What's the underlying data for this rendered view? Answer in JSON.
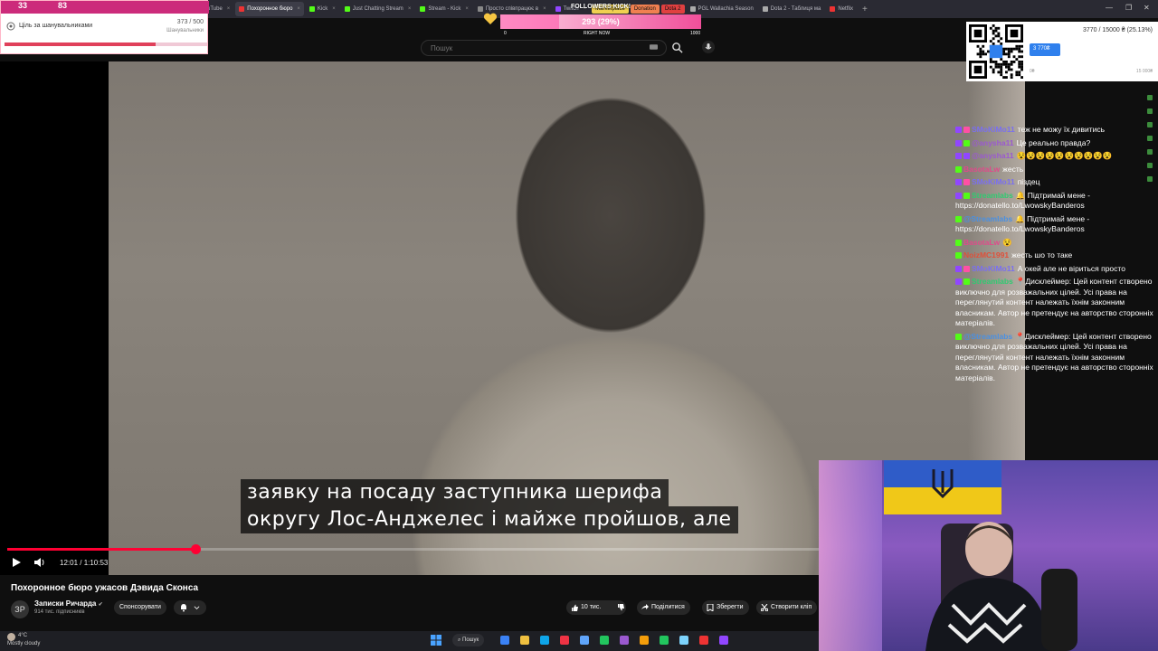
{
  "browser": {
    "tabs": [
      {
        "label": "Ніхто не очікує де",
        "color": "#e33"
      },
      {
        "label": "Я СКОРО УМРУ. БУД",
        "color": "#e33"
      },
      {
        "label": "PENGBORN - YouTube",
        "color": "#e33"
      },
      {
        "label": "Похоронное бюро",
        "color": "#e33",
        "active": true
      },
      {
        "label": "Kick",
        "color": "#53fc18"
      },
      {
        "label": "Just Chatting Stream",
        "color": "#53fc18"
      },
      {
        "label": "Stream - Kick",
        "color": "#53fc18"
      },
      {
        "label": "Просто співпрацює в",
        "color": "#888"
      },
      {
        "label": "Twitch",
        "color": "#9146ff"
      }
    ],
    "pills": [
      {
        "label": "Marketplace",
        "color": "#f0d050"
      },
      {
        "label": "Donation",
        "color": "#f08050"
      },
      {
        "label": "Dota 2",
        "color": "#e04040"
      }
    ],
    "extra_tabs": [
      {
        "label": "PGL Wallachia Season",
        "color": "#aaa"
      },
      {
        "label": "Dota 2 - Таблиця ма",
        "color": "#aaa"
      },
      {
        "label": "Netflix",
        "color": "#e33"
      }
    ],
    "newtab": "+",
    "window_controls": [
      "⌄",
      "—",
      "❐",
      "✕"
    ]
  },
  "youtube": {
    "search_placeholder": "Пошук",
    "video": {
      "subtitle_lines": [
        "заявку на посаду заступника шерифа",
        "округу Лос-Анджелес і майже пройшов, але"
      ],
      "time": "12:01 / 1:10:53",
      "progress_fraction": 0.2319
    },
    "title": "Похоронное бюро ужасов Дэвида Сконса",
    "channel": {
      "avatar_text": "ЗР",
      "name": "Записки Ричарда",
      "verified": "✔",
      "subs": "914 тис. підписників"
    },
    "sponsor_label": "Спонсорувати",
    "actions": {
      "like": "10 тис.",
      "share": "Поділитися",
      "save": "Зберегти",
      "clip": "Створити кліп"
    }
  },
  "overlay": {
    "stats": {
      "a": "33",
      "b": "83"
    },
    "goal": {
      "label": "Ціль за шанувальниками",
      "count": "373 / 500",
      "sub": "Шанувальники",
      "fraction": 0.746
    },
    "kick": {
      "title": "FOLLOWERS KICK!",
      "value": "293 (29%)",
      "fraction": 0.293,
      "min": "0",
      "mid": "RIGHT NOW",
      "max": "1000"
    },
    "donation": {
      "total": "3770 / 15000 ₴ (25.13%)",
      "bar_label": "3 770₴",
      "amount": "",
      "min": "0₴",
      "max": "15 000₴",
      "fraction": 0.2513
    }
  },
  "chat": [
    {
      "user": "SMoKiMo11",
      "user_color": "#7a6ff0",
      "badges": [
        "#9146ff",
        "#ff4fa5"
      ],
      "text": "теж не можу їх дивитись"
    },
    {
      "user": "@anysha11",
      "user_color": "#9b59d0",
      "badges": [
        "#9146ff",
        "#53fc18"
      ],
      "text": "Це реально правда?"
    },
    {
      "user": "@anysha11",
      "user_color": "#9b59d0",
      "badges": [
        "#9146ff",
        "#9146ff"
      ],
      "text": "😵😵😵😵😵😵😵😵😵😵"
    },
    {
      "user": "BasotaLw",
      "user_color": "#e04a8a",
      "badges": [
        "#53fc18"
      ],
      "text": "жесть"
    },
    {
      "user": "SMoKiMo11",
      "user_color": "#7a6ff0",
      "badges": [
        "#9146ff",
        "#ff4fa5"
      ],
      "text": "піздец"
    },
    {
      "user": "Streamlabs",
      "user_color": "#2ecc71",
      "badges": [
        "#9146ff",
        "#53fc18"
      ],
      "text": "🔔 Підтримай мене - https://donatello.to/LwowskyBanderos"
    },
    {
      "user": "@Streamlabs",
      "user_color": "#4a90e2",
      "badges": [
        "#53fc18"
      ],
      "text": "🔔 Підтримай мене - https://donatello.to/LwowskyBanderos"
    },
    {
      "user": "BasotaLw",
      "user_color": "#e04a8a",
      "badges": [
        "#53fc18"
      ],
      "text": "😵"
    },
    {
      "user": "NoizMC1991",
      "user_color": "#e0503a",
      "badges": [
        "#53fc18"
      ],
      "text": "жесть шо то таке"
    },
    {
      "user": "SMoKiMo11",
      "user_color": "#7a6ff0",
      "badges": [
        "#9146ff",
        "#ff4fa5"
      ],
      "text": "А окей але не віриться просто"
    },
    {
      "user": "Streamlabs",
      "user_color": "#2ecc71",
      "badges": [
        "#9146ff",
        "#53fc18"
      ],
      "text": "📍Дисклеймер: Цей контент створено виключно для розважальних цілей. Усі права на переглянутий контент належать їхнім законним власникам. Автор не претендує на авторство сторонніх матеріалів."
    },
    {
      "user": "@Streamlabs",
      "user_color": "#4a90e2",
      "badges": [
        "#53fc18"
      ],
      "text": "📍Дисклеймер: Цей контент створено виключно для розважальних цілей. Усі права на переглянутий контент належать їхнім законним власникам. Автор не претендує на авторство сторонніх матеріалів."
    }
  ],
  "taskbar": {
    "weather_temp": "4°C",
    "weather_desc": "Mostly cloudy",
    "search_label": "Пошук",
    "icons": [
      "#3b82f6",
      "#f0c040",
      "#0ea5e9",
      "#e34",
      "#60a5fa",
      "#22c55e",
      "#9b59d0",
      "#f59e0b",
      "#22c55e",
      "#7dd3fc",
      "#e33",
      "#9146ff"
    ]
  },
  "colors": {
    "accent_red": "#ff0033",
    "kick_green": "#53fc18",
    "twitch_purple": "#9146ff"
  }
}
